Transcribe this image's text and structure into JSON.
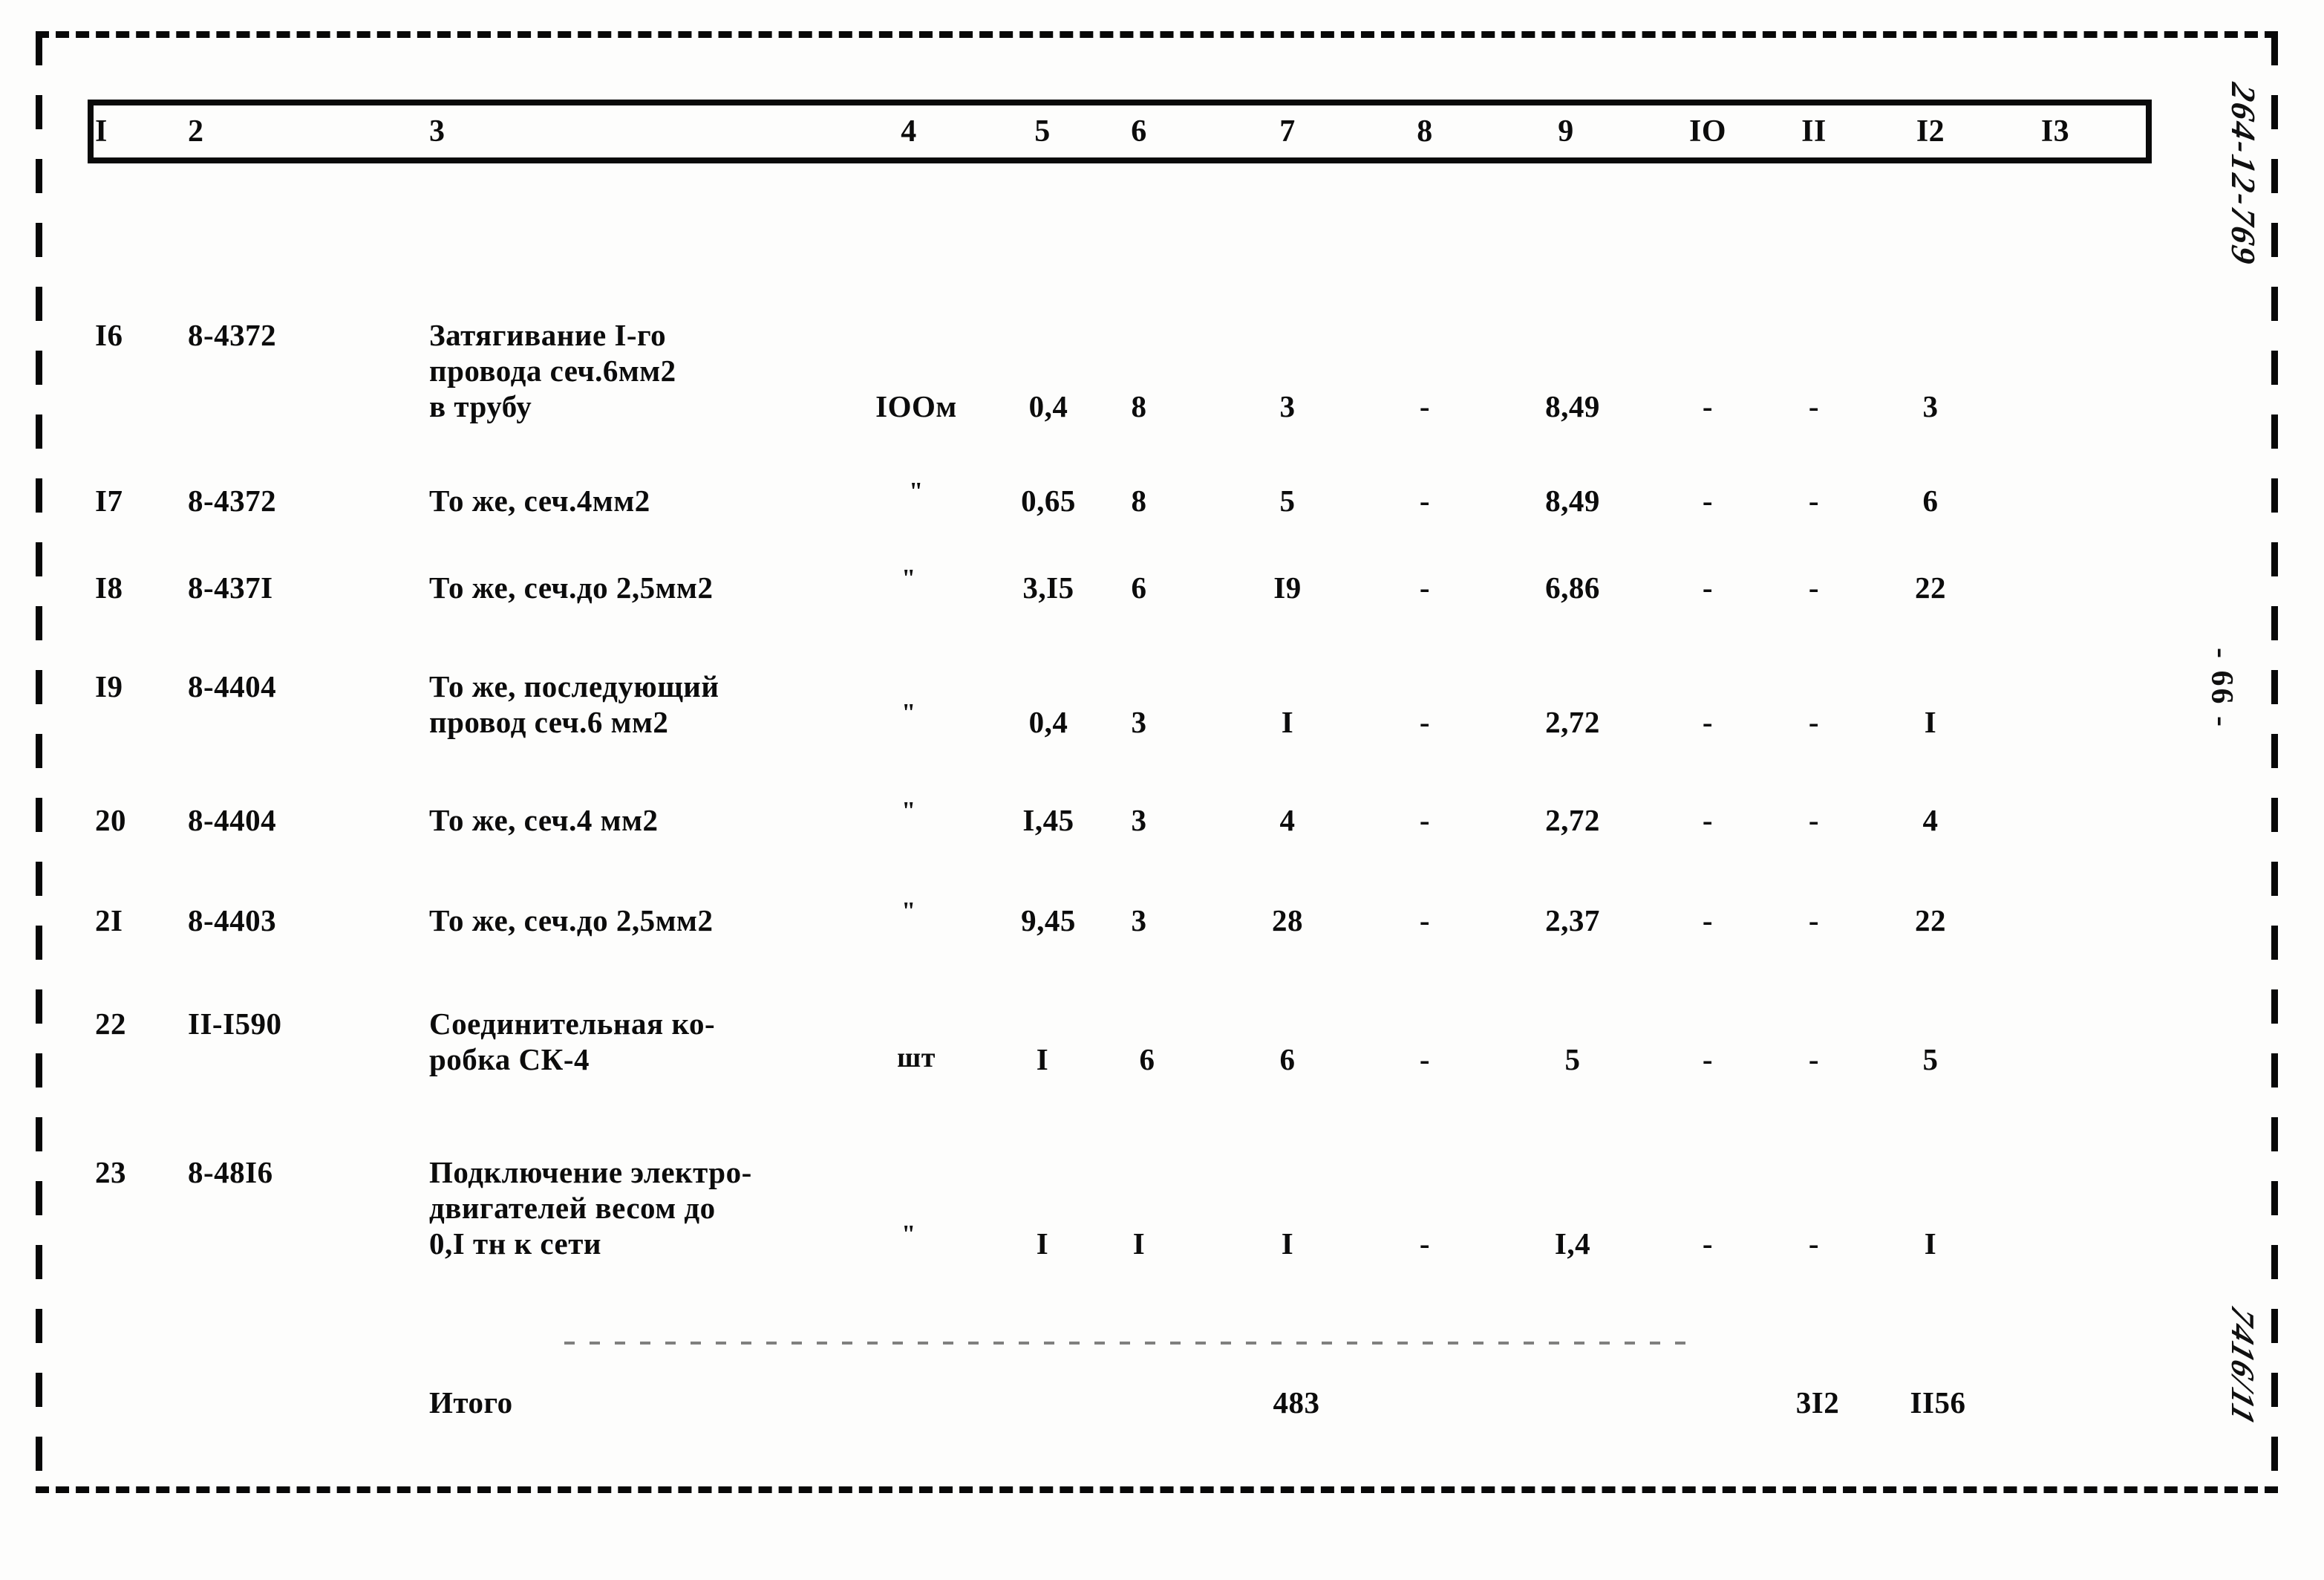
{
  "document": {
    "page_label": "- 66 -",
    "archive_code": "264-12-769",
    "stamp_code": "7416/11"
  },
  "table": {
    "column_headers": [
      "I",
      "2",
      "3",
      "4",
      "5",
      "6",
      "7",
      "8",
      "9",
      "IO",
      "II",
      "I2",
      "I3"
    ],
    "rows": [
      {
        "c1": "I6",
        "c2": "8-4372",
        "c3": [
          "Затягивание I-го",
          "провода сеч.6мм2",
          "в трубу"
        ],
        "c4": "IOOм",
        "c5": "0,4",
        "c6": "8",
        "c7": "3",
        "c8": "-",
        "c9": "8,49",
        "c10": "-",
        "c11": "-",
        "c12": "3",
        "c13": ""
      },
      {
        "c1": "I7",
        "c2": "8-4372",
        "c3": [
          "То же, сеч.4мм2"
        ],
        "c4": "\"",
        "c5": "0,65",
        "c6": "8",
        "c7": "5",
        "c8": "-",
        "c9": "8,49",
        "c10": "-",
        "c11": "-",
        "c12": "6",
        "c13": ""
      },
      {
        "c1": "I8",
        "c2": "8-437I",
        "c3": [
          "То же, сеч.до 2,5мм2"
        ],
        "c4": "\"",
        "c5": "3,I5",
        "c6": "6",
        "c7": "I9",
        "c8": "-",
        "c9": "6,86",
        "c10": "-",
        "c11": "-",
        "c12": "22",
        "c13": ""
      },
      {
        "c1": "I9",
        "c2": "8-4404",
        "c3": [
          "То же, последующий",
          "провод сеч.6 мм2"
        ],
        "c4": "\"",
        "c5": "0,4",
        "c6": "3",
        "c7": "I",
        "c8": "-",
        "c9": "2,72",
        "c10": "-",
        "c11": "-",
        "c12": "I",
        "c13": ""
      },
      {
        "c1": "20",
        "c2": "8-4404",
        "c3": [
          "То же, сеч.4 мм2"
        ],
        "c4": "\"",
        "c5": "I,45",
        "c6": "3",
        "c7": "4",
        "c8": "-",
        "c9": "2,72",
        "c10": "-",
        "c11": "-",
        "c12": "4",
        "c13": ""
      },
      {
        "c1": "2I",
        "c2": "8-4403",
        "c3": [
          "То же, сеч.до 2,5мм2"
        ],
        "c4": "\"",
        "c5": "9,45",
        "c6": "3",
        "c7": "28",
        "c8": "-",
        "c9": "2,37",
        "c10": "-",
        "c11": "-",
        "c12": "22",
        "c13": ""
      },
      {
        "c1": "22",
        "c2": "II-I590",
        "c3": [
          "Соединительная ко-",
          "робка СК-4"
        ],
        "c4": "шт",
        "c5": "I",
        "c6": "6",
        "c7": "6",
        "c8": "-",
        "c9": "5",
        "c10": "-",
        "c11": "-",
        "c12": "5",
        "c13": ""
      },
      {
        "c1": "23",
        "c2": "8-48I6",
        "c3": [
          "Подключение электро-",
          "двигателей весом до",
          "0,I тн к сети"
        ],
        "c4": "\"",
        "c5": "I",
        "c6": "I",
        "c7": "I",
        "c8": "-",
        "c9": "I,4",
        "c10": "-",
        "c11": "-",
        "c12": "I",
        "c13": ""
      }
    ],
    "totals": {
      "label": "Итого",
      "c7": "483",
      "c11": "3I2",
      "c12": "II56"
    }
  }
}
